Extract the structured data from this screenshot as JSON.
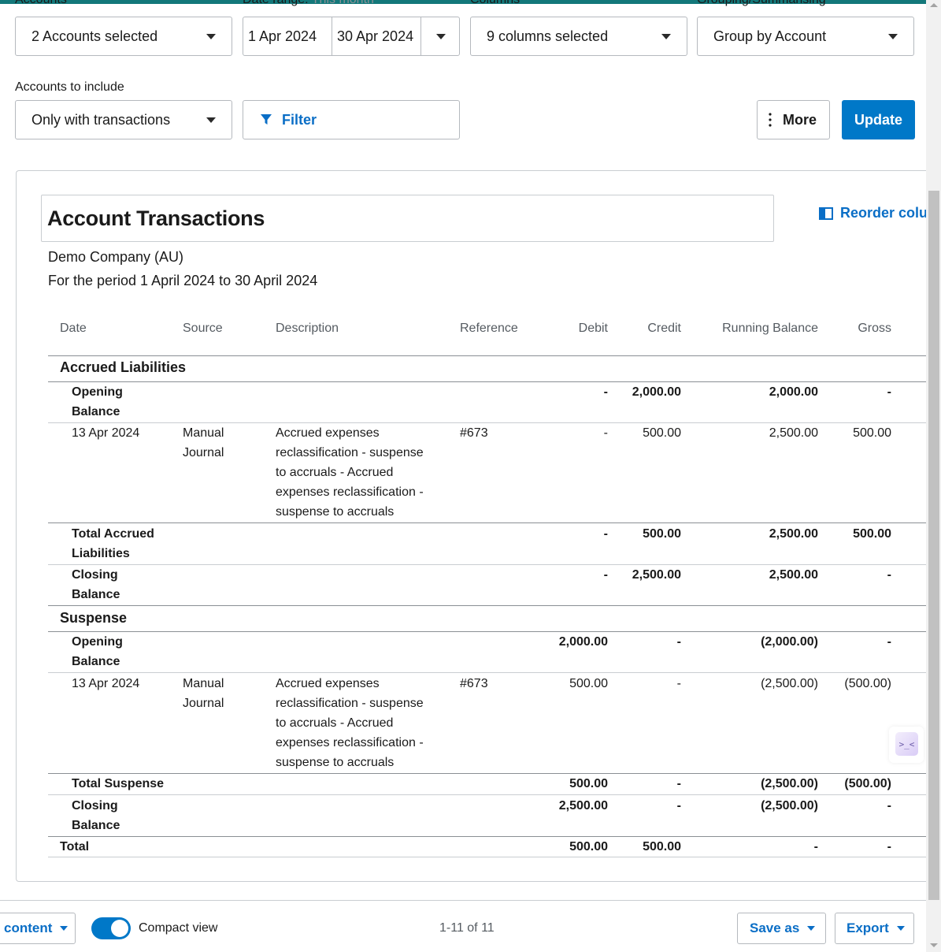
{
  "controls": {
    "accounts_label": "Accounts",
    "accounts_value": "2 Accounts selected",
    "date_range_label": "Date range:",
    "date_range_hint": "This month",
    "date_from": "1 Apr 2024",
    "date_to": "30 Apr 2024",
    "columns_label": "Columns",
    "columns_value": "9 columns selected",
    "grouping_label": "Grouping/Summarising",
    "grouping_value": "Group by Account",
    "include_label": "Accounts to include",
    "include_value": "Only with transactions",
    "filter_label": "Filter",
    "more_label": "More",
    "update_label": "Update"
  },
  "report": {
    "title": "Account Transactions",
    "reorder_label": "Reorder colu",
    "company": "Demo Company (AU)",
    "period": "For the period 1 April 2024 to 30 April 2024",
    "columns": [
      "Date",
      "Source",
      "Description",
      "Reference",
      "Debit",
      "Credit",
      "Running Balance",
      "Gross"
    ],
    "groups": [
      {
        "name": "Accrued Liabilities",
        "opening": {
          "label1": "Opening",
          "label2": "Balance",
          "debit": "-",
          "credit": "2,000.00",
          "running": "2,000.00",
          "gross": "-"
        },
        "txn": {
          "date": "13 Apr 2024",
          "source1": "Manual",
          "source2": "Journal",
          "desc": [
            "Accrued expenses",
            "reclassification - suspense",
            "to accruals - Accrued",
            "expenses reclassification -",
            "suspense to accruals"
          ],
          "reference": "#673",
          "debit": "-",
          "credit": "500.00",
          "running": "2,500.00",
          "gross": "500.00"
        },
        "total": {
          "label1": "Total Accrued",
          "label2": "Liabilities",
          "debit": "-",
          "credit": "500.00",
          "running": "2,500.00",
          "gross": "500.00"
        },
        "closing": {
          "label1": "Closing",
          "label2": "Balance",
          "debit": "-",
          "credit": "2,500.00",
          "running": "2,500.00",
          "gross": "-"
        }
      },
      {
        "name": "Suspense",
        "opening": {
          "label1": "Opening",
          "label2": "Balance",
          "debit": "2,000.00",
          "credit": "-",
          "running": "(2,000.00)",
          "gross": "-"
        },
        "txn": {
          "date": "13 Apr 2024",
          "source1": "Manual",
          "source2": "Journal",
          "desc": [
            "Accrued expenses",
            "reclassification - suspense",
            "to accruals - Accrued",
            "expenses reclassification -",
            "suspense to accruals"
          ],
          "reference": "#673",
          "debit": "500.00",
          "credit": "-",
          "running": "(2,500.00)",
          "gross": "(500.00)"
        },
        "total": {
          "label1": "Total Suspense",
          "label2": "",
          "debit": "500.00",
          "credit": "-",
          "running": "(2,500.00)",
          "gross": "(500.00)"
        },
        "closing": {
          "label1": "Closing",
          "label2": "Balance",
          "debit": "2,500.00",
          "credit": "-",
          "running": "(2,500.00)",
          "gross": "-"
        }
      }
    ],
    "grand_total": {
      "label": "Total",
      "debit": "500.00",
      "credit": "500.00",
      "running": "-",
      "gross": "-"
    }
  },
  "footer": {
    "content_label": "content",
    "compact_label": "Compact view",
    "compact_on": true,
    "pager": "1-11 of 11",
    "save_as_label": "Save as",
    "export_label": "Export"
  },
  "icons": [
    "chevron-down-icon",
    "filter-icon",
    "more-vertical-icon",
    "columns-icon",
    "assistant-icon"
  ],
  "colors": {
    "accent": "#0078c8",
    "link": "#0a6ec6",
    "topbar": "#13787a"
  }
}
